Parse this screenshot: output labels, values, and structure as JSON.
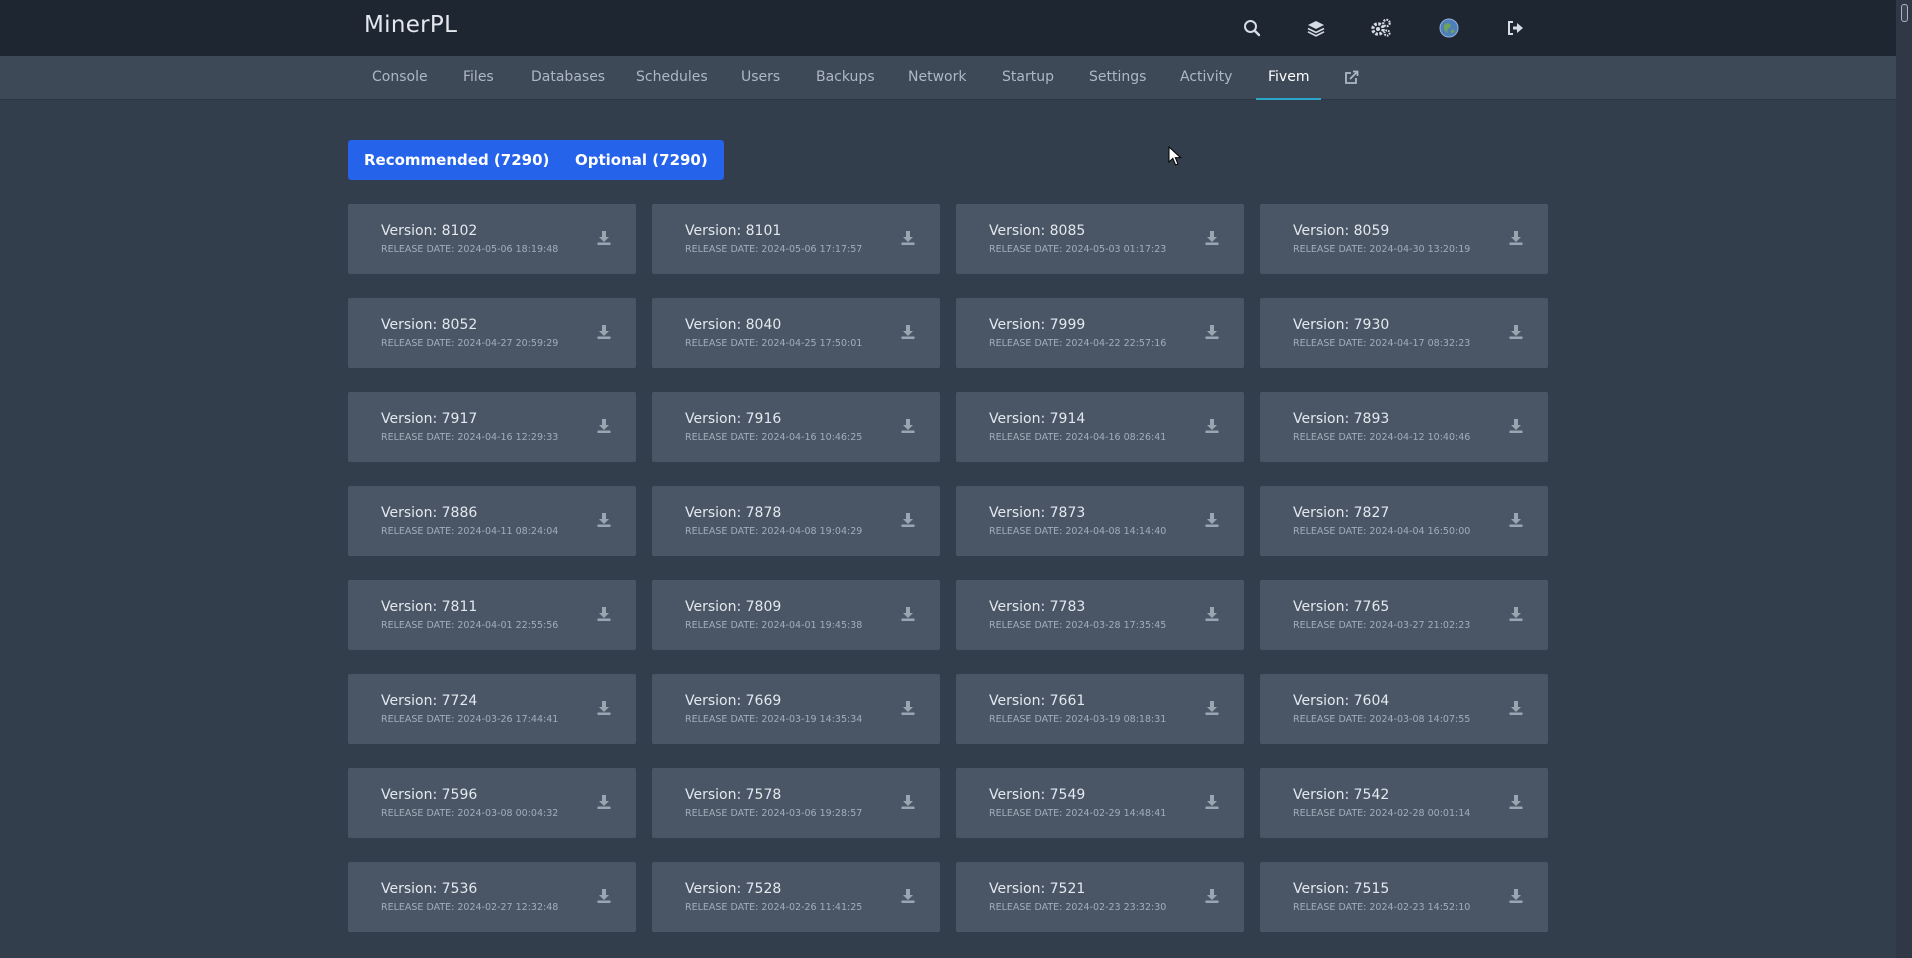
{
  "header": {
    "brand": "MinerPL",
    "icons": [
      "search-icon",
      "layers-icon",
      "settings-icon",
      "avatar",
      "logout-icon"
    ]
  },
  "nav": {
    "items": [
      {
        "label": "Console"
      },
      {
        "label": "Files"
      },
      {
        "label": "Databases"
      },
      {
        "label": "Schedules"
      },
      {
        "label": "Users"
      },
      {
        "label": "Backups"
      },
      {
        "label": "Network"
      },
      {
        "label": "Startup"
      },
      {
        "label": "Settings"
      },
      {
        "label": "Activity"
      },
      {
        "label": "Fivem"
      }
    ],
    "active": "Fivem",
    "external_icon": "external-link-icon"
  },
  "buttons": {
    "recommended": "Recommended (7290)",
    "optional": "Optional (7290)"
  },
  "versions": [
    {
      "version": "Version: 8102",
      "release": "RELEASE DATE: 2024-05-06 18:19:48"
    },
    {
      "version": "Version: 8101",
      "release": "RELEASE DATE: 2024-05-06 17:17:57"
    },
    {
      "version": "Version: 8085",
      "release": "RELEASE DATE: 2024-05-03 01:17:23"
    },
    {
      "version": "Version: 8059",
      "release": "RELEASE DATE: 2024-04-30 13:20:19"
    },
    {
      "version": "Version: 8052",
      "release": "RELEASE DATE: 2024-04-27 20:59:29"
    },
    {
      "version": "Version: 8040",
      "release": "RELEASE DATE: 2024-04-25 17:50:01"
    },
    {
      "version": "Version: 7999",
      "release": "RELEASE DATE: 2024-04-22 22:57:16"
    },
    {
      "version": "Version: 7930",
      "release": "RELEASE DATE: 2024-04-17 08:32:23"
    },
    {
      "version": "Version: 7917",
      "release": "RELEASE DATE: 2024-04-16 12:29:33"
    },
    {
      "version": "Version: 7916",
      "release": "RELEASE DATE: 2024-04-16 10:46:25"
    },
    {
      "version": "Version: 7914",
      "release": "RELEASE DATE: 2024-04-16 08:26:41"
    },
    {
      "version": "Version: 7893",
      "release": "RELEASE DATE: 2024-04-12 10:40:46"
    },
    {
      "version": "Version: 7886",
      "release": "RELEASE DATE: 2024-04-11 08:24:04"
    },
    {
      "version": "Version: 7878",
      "release": "RELEASE DATE: 2024-04-08 19:04:29"
    },
    {
      "version": "Version: 7873",
      "release": "RELEASE DATE: 2024-04-08 14:14:40"
    },
    {
      "version": "Version: 7827",
      "release": "RELEASE DATE: 2024-04-04 16:50:00"
    },
    {
      "version": "Version: 7811",
      "release": "RELEASE DATE: 2024-04-01 22:55:56"
    },
    {
      "version": "Version: 7809",
      "release": "RELEASE DATE: 2024-04-01 19:45:38"
    },
    {
      "version": "Version: 7783",
      "release": "RELEASE DATE: 2024-03-28 17:35:45"
    },
    {
      "version": "Version: 7765",
      "release": "RELEASE DATE: 2024-03-27 21:02:23"
    },
    {
      "version": "Version: 7724",
      "release": "RELEASE DATE: 2024-03-26 17:44:41"
    },
    {
      "version": "Version: 7669",
      "release": "RELEASE DATE: 2024-03-19 14:35:34"
    },
    {
      "version": "Version: 7661",
      "release": "RELEASE DATE: 2024-03-19 08:18:31"
    },
    {
      "version": "Version: 7604",
      "release": "RELEASE DATE: 2024-03-08 14:07:55"
    },
    {
      "version": "Version: 7596",
      "release": "RELEASE DATE: 2024-03-08 00:04:32"
    },
    {
      "version": "Version: 7578",
      "release": "RELEASE DATE: 2024-03-06 19:28:57"
    },
    {
      "version": "Version: 7549",
      "release": "RELEASE DATE: 2024-02-29 14:48:41"
    },
    {
      "version": "Version: 7542",
      "release": "RELEASE DATE: 2024-02-28 00:01:14"
    },
    {
      "version": "Version: 7536",
      "release": "RELEASE DATE: 2024-02-27 12:32:48"
    },
    {
      "version": "Version: 7528",
      "release": "RELEASE DATE: 2024-02-26 11:41:25"
    },
    {
      "version": "Version: 7521",
      "release": "RELEASE DATE: 2024-02-23 23:32:30"
    },
    {
      "version": "Version: 7515",
      "release": "RELEASE DATE: 2024-02-23 14:52:10"
    }
  ],
  "colors": {
    "accent": "#2563eb",
    "tab_underline": "#2ba6c9",
    "background": "#333e4c",
    "card": "#4a5665"
  }
}
